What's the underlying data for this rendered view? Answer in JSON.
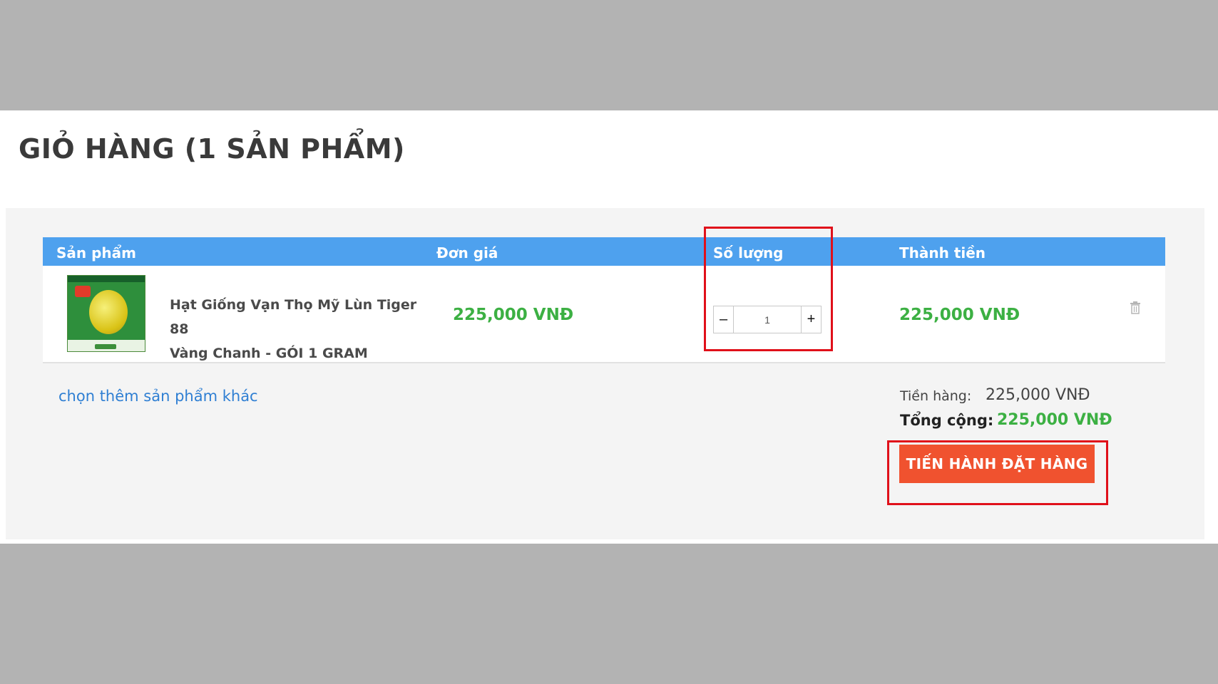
{
  "page_title": "GIỎ HÀNG (1 SẢN PHẨM)",
  "table": {
    "headers": [
      "Sản phẩm",
      "Đơn giá",
      "Số lượng",
      "Thành tiền"
    ]
  },
  "item": {
    "name_line1": "Hạt Giống Vạn Thọ Mỹ Lùn Tiger 88",
    "name_line2": "Vàng Chanh - GÓI 1 GRAM",
    "unit_price": "225,000 VNĐ",
    "quantity": "1",
    "line_total": "225,000 VNĐ",
    "decrement_label": "–",
    "increment_label": "+",
    "delete_icon": "trash-icon",
    "image_icon": "product-thumbnail"
  },
  "continue_link": "chọn thêm sản phẩm khác",
  "summary": {
    "subtotal_label": "Tiền hàng:",
    "subtotal_value": "225,000 VNĐ",
    "total_label": "Tổng cộng:",
    "total_value": "225,000 VNĐ"
  },
  "checkout_label": "TIẾN HÀNH ĐẶT HÀNG",
  "colors": {
    "header_blue": "#4ea1ee",
    "price_green": "#3cb043",
    "checkout_orange": "#f0522f",
    "highlight_red": "#e0101a"
  }
}
